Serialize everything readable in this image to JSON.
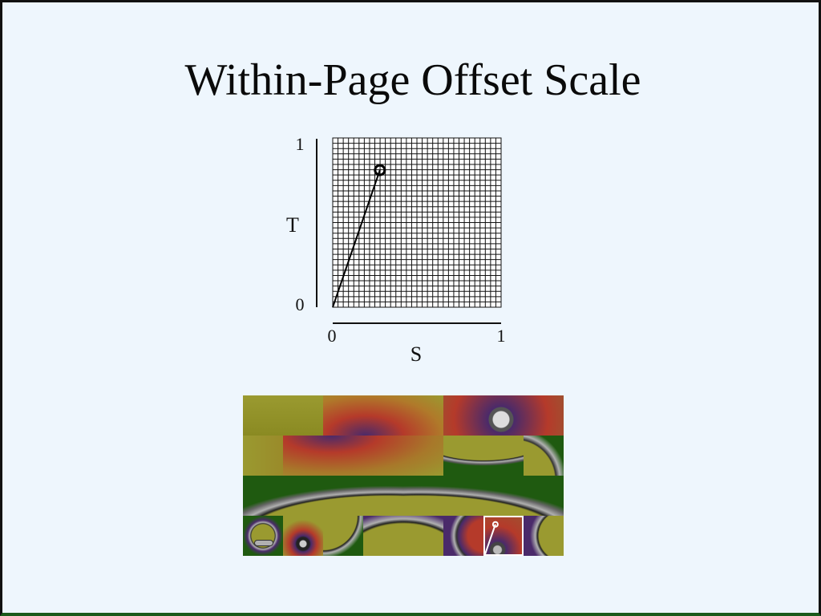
{
  "slide": {
    "title": "Within-Page Offset Scale"
  },
  "plot": {
    "x_label": "S",
    "y_label": "T",
    "x_ticks": [
      "0",
      "1"
    ],
    "y_ticks": [
      "0",
      "1"
    ],
    "grid_divisions": 32,
    "selected_point": {
      "s": 0.28,
      "t": 0.81
    },
    "colors": {
      "grid": "#111111",
      "background": "#ffffff",
      "line": "#000000"
    }
  },
  "texture_mosaic": {
    "colors": {
      "olive": "#8a8a22",
      "yellow": "#9a9a30",
      "red": "#b53a2a",
      "purple": "#4a2a6a",
      "green": "#1f5a10",
      "gray": "#b0b0b0",
      "highlight": "#ffffff"
    },
    "highlight_point": {
      "s": 0.28,
      "t": 0.81
    }
  }
}
